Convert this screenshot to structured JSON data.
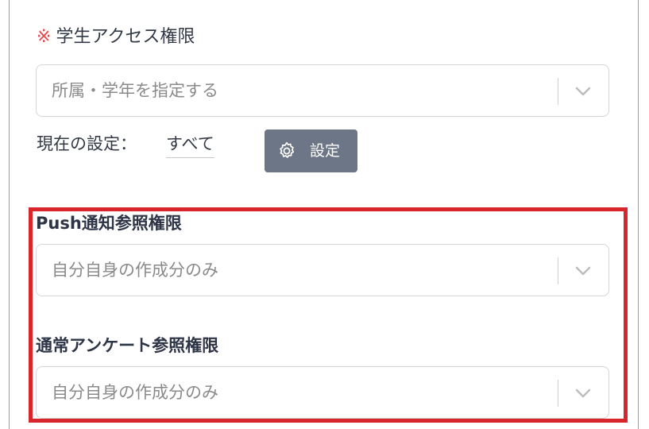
{
  "student_access": {
    "required_mark": "※",
    "label": "学生アクセス権限",
    "select_placeholder": "所属・学年を指定する",
    "current_setting_label": "現在の設定：",
    "current_setting_value": "すべて",
    "settings_button_label": "設定"
  },
  "push_reference": {
    "label": "Push通知参照権限",
    "select_value": "自分自身の作成分のみ"
  },
  "survey_reference": {
    "label": "通常アンケート参照権限",
    "select_value": "自分自身の作成分のみ"
  },
  "colors": {
    "required": "#e4484c",
    "button_bg": "#6c7687",
    "highlight": "#d9262c",
    "frame": "#8a96ea"
  },
  "icons": {
    "dropdown": "chevron-down-icon",
    "settings": "gear-icon"
  }
}
